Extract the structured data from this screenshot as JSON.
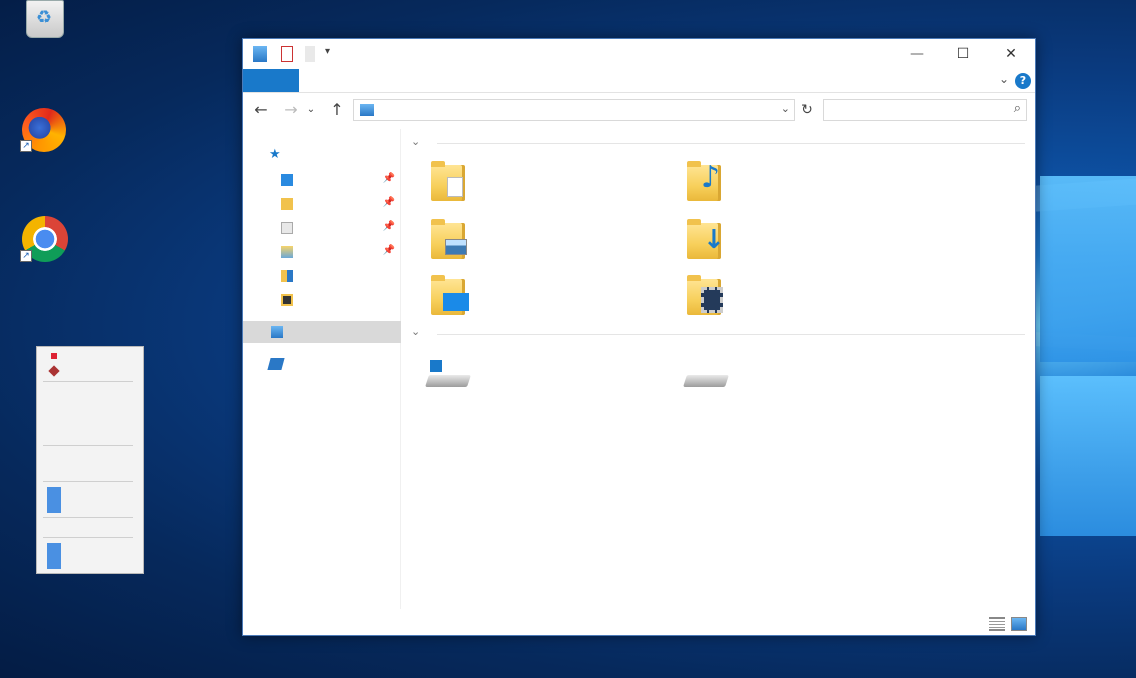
{
  "desktop": {
    "icons": [
      {
        "name": "recycle-bin-icon"
      },
      {
        "name": "firefox-icon"
      },
      {
        "name": "chrome-icon"
      }
    ]
  },
  "explorer": {
    "title_controls": {
      "minimize": "—",
      "maximize": "☐",
      "close": "✕"
    },
    "ribbon": {
      "help": "?",
      "expand": "⌄"
    },
    "nav": {
      "back": "←",
      "forward": "→",
      "recent": "⌄",
      "up": "↑",
      "refresh": "↻",
      "search": "⌕",
      "address_dropdown": "⌄"
    },
    "groups": [
      {
        "toggle": "⌄"
      },
      {
        "toggle": "⌄"
      }
    ],
    "colors": {
      "accent": "#1979ca",
      "folder": "#f7cf5a",
      "selection": "#d9d9d9"
    }
  }
}
